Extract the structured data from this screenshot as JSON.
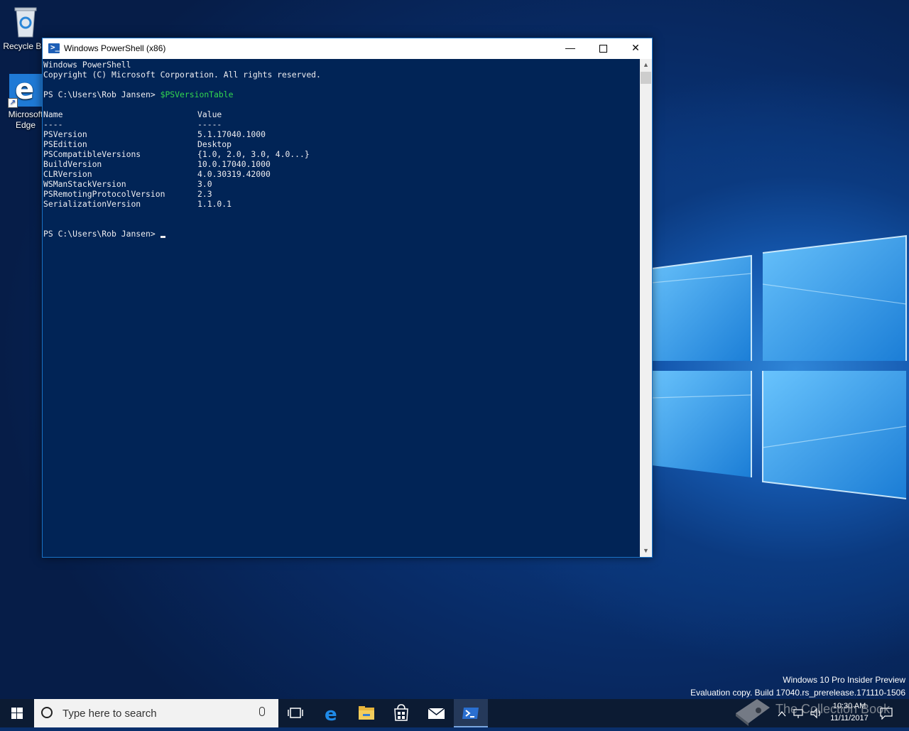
{
  "desktop": {
    "icons": [
      {
        "label": "Recycle Bin",
        "icon": "recycle-bin-icon"
      },
      {
        "label": "Microsoft Edge",
        "icon": "edge-icon"
      }
    ],
    "watermark": {
      "line1": "Windows 10 Pro Insider Preview",
      "line2": "Evaluation copy. Build 17040.rs_prerelease.171110-1506"
    },
    "overlay_logo_text": "The Collection Book"
  },
  "window": {
    "title": "Windows PowerShell (x86)",
    "controls": {
      "minimize": "—",
      "close": "✕"
    },
    "console": {
      "header": [
        "Windows PowerShell",
        "Copyright (C) Microsoft Corporation. All rights reserved."
      ],
      "prompt": "PS C:\\Users\\Rob Jansen>",
      "command": "$PSVersionTable",
      "table": {
        "headers": [
          "Name",
          "Value"
        ],
        "underline": [
          "----",
          "-----"
        ],
        "rows": [
          [
            "PSVersion",
            "5.1.17040.1000"
          ],
          [
            "PSEdition",
            "Desktop"
          ],
          [
            "PSCompatibleVersions",
            "{1.0, 2.0, 3.0, 4.0...}"
          ],
          [
            "BuildVersion",
            "10.0.17040.1000"
          ],
          [
            "CLRVersion",
            "4.0.30319.42000"
          ],
          [
            "WSManStackVersion",
            "3.0"
          ],
          [
            "PSRemotingProtocolVersion",
            "2.3"
          ],
          [
            "SerializationVersion",
            "1.1.0.1"
          ]
        ]
      },
      "final_prompt": "PS C:\\Users\\Rob Jansen>"
    }
  },
  "taskbar": {
    "search_placeholder": "Type here to search",
    "apps": [
      "task-view-icon",
      "edge-icon",
      "file-explorer-icon",
      "store-icon",
      "mail-icon",
      "powershell-icon"
    ],
    "clock": {
      "time": "10:30 AM",
      "date": "11/11/2017"
    }
  },
  "colors": {
    "console_bg": "#012456",
    "console_fg": "#eeedf0",
    "command": "#33d64f",
    "taskbar": "#0c1b33"
  }
}
